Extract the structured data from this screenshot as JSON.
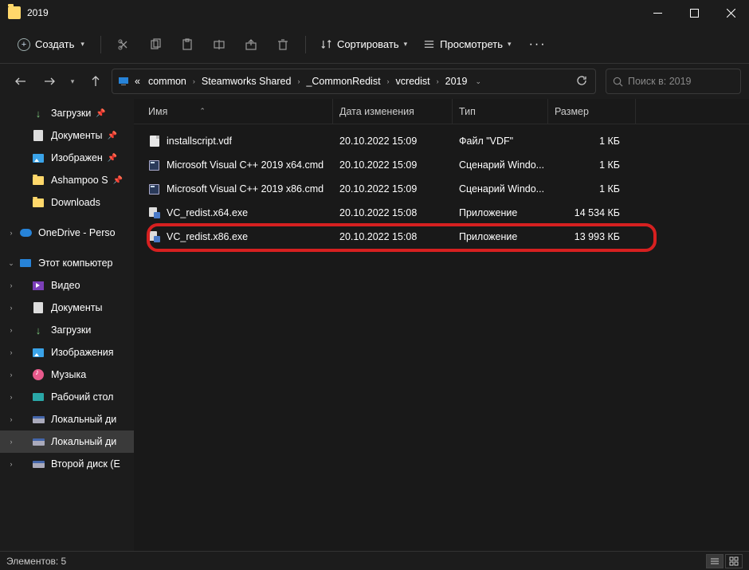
{
  "title": "2019",
  "toolbar": {
    "create": "Создать",
    "sort": "Сортировать",
    "view": "Просмотреть"
  },
  "breadcrumbs": {
    "overflow": "«",
    "segments": [
      "common",
      "Steamworks Shared",
      "_CommonRedist",
      "vcredist",
      "2019"
    ]
  },
  "search": {
    "placeholder": "Поиск в: 2019"
  },
  "sidebar": {
    "items": [
      {
        "label": "Загрузки"
      },
      {
        "label": "Документы"
      },
      {
        "label": "Изображен"
      },
      {
        "label": "Ashampoo S"
      },
      {
        "label": "Downloads"
      },
      {
        "label": "OneDrive - Perso"
      },
      {
        "label": "Этот компьютер"
      },
      {
        "label": "Видео"
      },
      {
        "label": "Документы"
      },
      {
        "label": "Загрузки"
      },
      {
        "label": "Изображения"
      },
      {
        "label": "Музыка"
      },
      {
        "label": "Рабочий стол"
      },
      {
        "label": "Локальный ди"
      },
      {
        "label": "Локальный ди"
      },
      {
        "label": "Второй диск (E"
      }
    ]
  },
  "columns": {
    "name": "Имя",
    "date": "Дата изменения",
    "type": "Тип",
    "size": "Размер"
  },
  "files": [
    {
      "name": "installscript.vdf",
      "date": "20.10.2022 15:09",
      "type": "Файл \"VDF\"",
      "size": "1 КБ",
      "icon": "generic"
    },
    {
      "name": "Microsoft Visual C++ 2019 x64.cmd",
      "date": "20.10.2022 15:09",
      "type": "Сценарий Windo...",
      "size": "1 КБ",
      "icon": "cmd"
    },
    {
      "name": "Microsoft Visual C++ 2019 x86.cmd",
      "date": "20.10.2022 15:09",
      "type": "Сценарий Windo...",
      "size": "1 КБ",
      "icon": "cmd"
    },
    {
      "name": "VC_redist.x64.exe",
      "date": "20.10.2022 15:08",
      "type": "Приложение",
      "size": "14 534 КБ",
      "icon": "exe"
    },
    {
      "name": "VC_redist.x86.exe",
      "date": "20.10.2022 15:08",
      "type": "Приложение",
      "size": "13 993 КБ",
      "icon": "exe"
    }
  ],
  "status": {
    "count": "Элементов: 5"
  }
}
